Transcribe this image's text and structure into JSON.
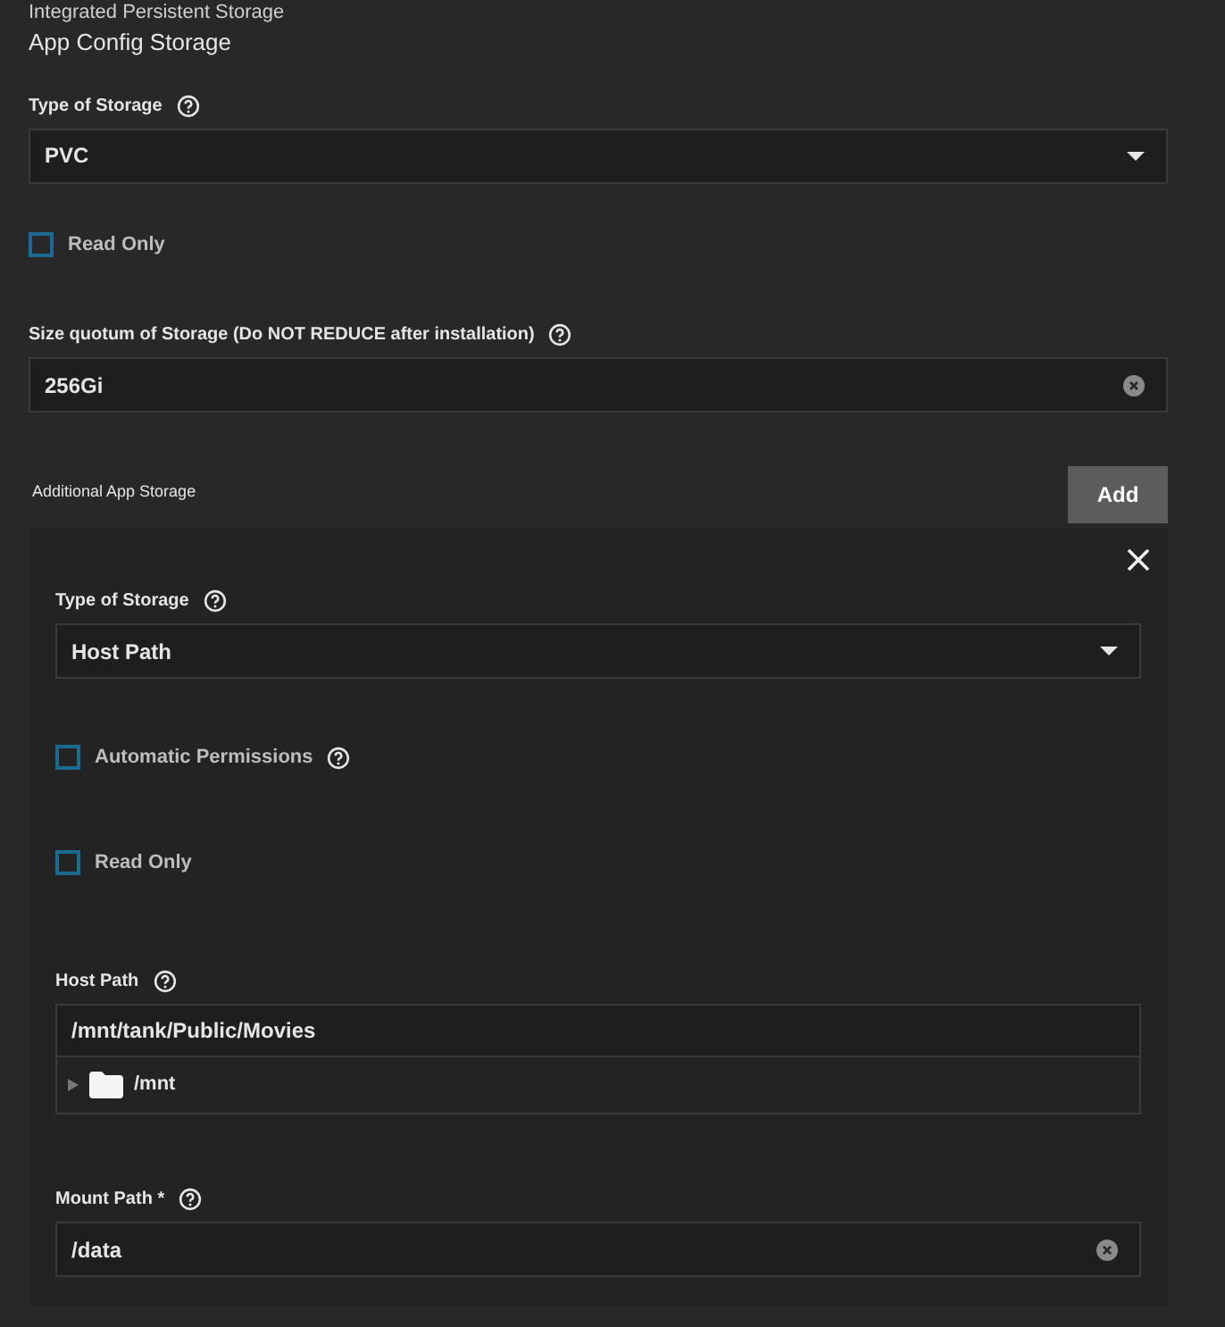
{
  "section_title": "Integrated Persistent Storage",
  "app_config": {
    "title": "App Config Storage",
    "type_of_storage": {
      "label": "Type of Storage",
      "value": "PVC"
    },
    "read_only": {
      "label": "Read Only",
      "checked": false
    },
    "size": {
      "label": "Size quotum of Storage (Do NOT REDUCE after installation)",
      "value": "256Gi"
    }
  },
  "additional": {
    "label": "Additional App Storage",
    "add_button": "Add",
    "items": [
      {
        "type_of_storage": {
          "label": "Type of Storage",
          "value": "Host Path"
        },
        "automatic_permissions": {
          "label": "Automatic Permissions",
          "checked": false
        },
        "read_only": {
          "label": "Read Only",
          "checked": false
        },
        "host_path": {
          "label": "Host Path",
          "value": "/mnt/tank/Public/Movies",
          "tree": [
            {
              "name": "/mnt",
              "expanded": false
            }
          ]
        },
        "mount_path": {
          "label": "Mount Path *",
          "value": "/data"
        }
      }
    ]
  }
}
